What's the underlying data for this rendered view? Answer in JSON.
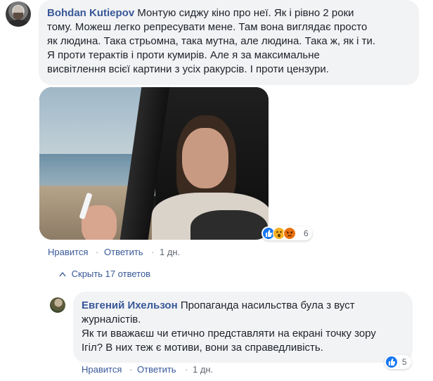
{
  "comment1": {
    "author": "Bohdan Kutiepov",
    "text_line1": "Монтую сиджу кіно про неї. Як і рівно 2 роки",
    "text_lines": [
      "тому. Можеш легко репресувати мене. Там вона виглядає просто",
      "як людина. Така стрьомна, така мутна, але людина. Така ж, як і ти.",
      "Я проти терактів і проти кумирів. Але я за максимальне",
      "висвітлення всієї картини з усіх ракурсів. І проти цензури."
    ],
    "reaction_count": "6",
    "actions": {
      "like": "Нравится",
      "reply": "Ответить",
      "time": "1 дн."
    },
    "hide_replies": "Скрыть 17 ответов"
  },
  "comment2": {
    "author": "Евгений Ихельзон",
    "text_line1": "Пропаганда насильства була з вуст",
    "text_lines": [
      "журналістів.",
      "Як ти вважаєш чи етично представляти на екрані точку зору",
      "Ігіл? В них теж є мотиви, вони за справедливість."
    ],
    "reaction_count": "5",
    "actions": {
      "like": "Нравится",
      "reply": "Ответить",
      "time": "1 дн."
    }
  },
  "colors": {
    "link": "#385898",
    "bubble": "#f2f3f5",
    "like": "#1877f2",
    "wow": "#f7b125",
    "angry": "#e9710f"
  },
  "icons": [
    "like-reaction-icon",
    "wow-reaction-icon",
    "angry-reaction-icon",
    "collapse-arrow-icon"
  ]
}
